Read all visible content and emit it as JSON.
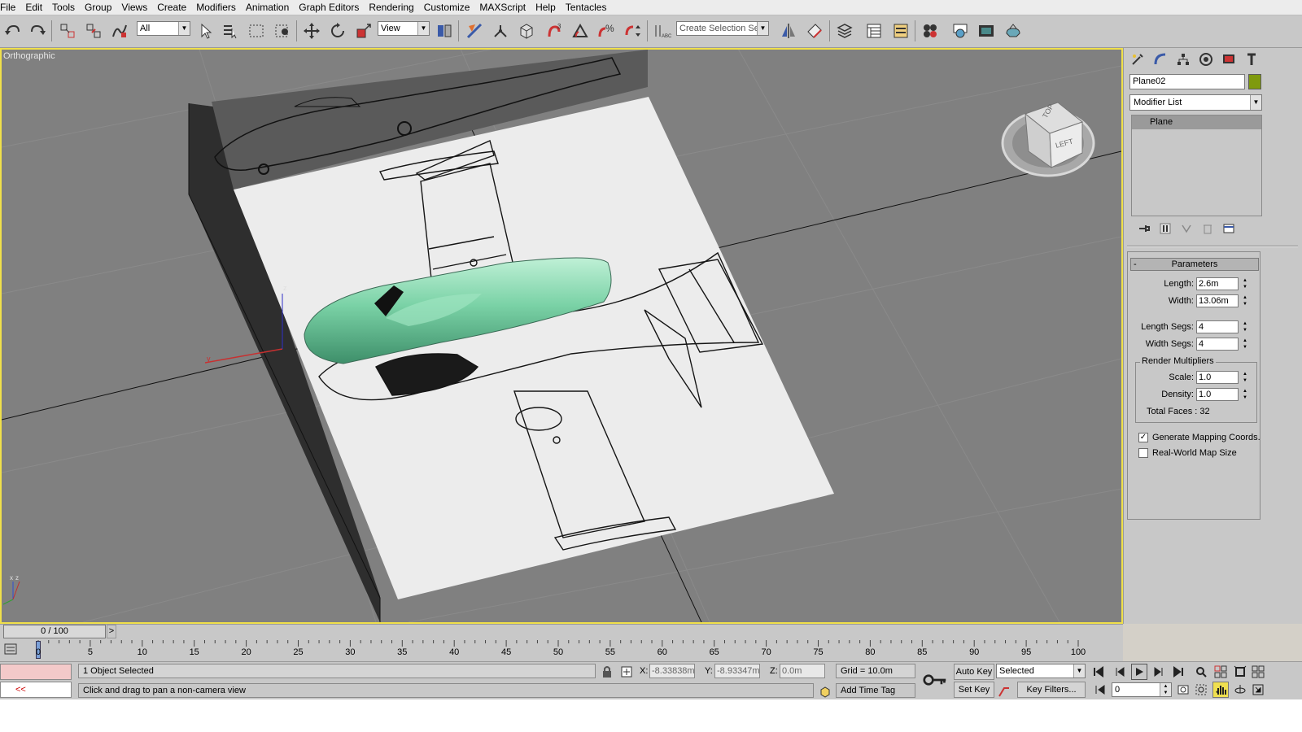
{
  "menu": [
    "File",
    "Edit",
    "Tools",
    "Group",
    "Views",
    "Create",
    "Modifiers",
    "Animation",
    "Graph Editors",
    "Rendering",
    "Customize",
    "MAXScript",
    "Help",
    "Tentacles"
  ],
  "toolbar": {
    "selection_filter": "All",
    "ref_coord": "View",
    "named_selection_placeholder": "Create Selection Set",
    "icons": [
      "undo-icon",
      "redo-icon",
      "select-link-icon",
      "unlink-icon",
      "bind-spacewarp-icon",
      "select-object-icon",
      "select-by-name-icon",
      "rect-region-icon",
      "window-crossing-icon",
      "move-icon",
      "rotate-icon",
      "scale-icon",
      "pivot-icon",
      "manipulate-icon",
      "keyboard-shortcut-icon",
      "snap-icon",
      "angle-snap-icon",
      "percent-snap-icon",
      "spinner-snap-icon",
      "edit-named-selection-icon",
      "mirror-icon",
      "align-icon",
      "layer-manager-icon",
      "ribbon-icon",
      "curve-editor-icon",
      "schematic-icon",
      "material-editor-icon",
      "render-setup-icon",
      "rendered-frame-icon",
      "render-icon"
    ]
  },
  "viewport": {
    "label": "Orthographic",
    "viewcube_top": "TOP",
    "viewcube_left": "LEFT",
    "axis_z": "z",
    "axis_y": "y",
    "tripod_x": "x",
    "tripod_z": "z"
  },
  "command_panel": {
    "object_name": "Plane02",
    "object_color": "#7f9a0e",
    "modifier_list": "Modifier List",
    "stack_item": "Plane",
    "rollout_title": "Parameters",
    "params": [
      {
        "label": "Length:",
        "value": "2.6m"
      },
      {
        "label": "Width:",
        "value": "13.06m"
      },
      {
        "label": "Length Segs:",
        "value": "4"
      },
      {
        "label": "Width Segs:",
        "value": "4"
      }
    ],
    "render_multipliers_title": "Render Multipliers",
    "scale_label": "Scale:",
    "scale_value": "1.0",
    "density_label": "Density:",
    "density_value": "1.0",
    "total_faces": "Total Faces : 32",
    "gen_mapping": "Generate Mapping Coords.",
    "gen_mapping_checked": true,
    "real_world": "Real-World Map Size",
    "real_world_checked": false
  },
  "timeline": {
    "frame_display": "0 / 100",
    "next_label": ">",
    "ticks": [
      "0",
      "5",
      "10",
      "15",
      "20",
      "25",
      "30",
      "35",
      "40",
      "45",
      "50",
      "55",
      "60",
      "65",
      "70",
      "75",
      "80",
      "85",
      "90",
      "95",
      "100"
    ]
  },
  "status": {
    "maxscript_btn": "<<",
    "selection_info": "1 Object Selected",
    "prompt": "Click and drag to pan a non-camera view",
    "x_label": "X:",
    "x_value": "-8.33838m",
    "y_label": "Y:",
    "y_value": "-8.93347m",
    "z_label": "Z:",
    "z_value": "0.0m",
    "grid": "Grid = 10.0m",
    "add_time_tag": "Add Time Tag",
    "auto_key": "Auto Key",
    "set_key": "Set Key",
    "selected_filter": "Selected",
    "key_filters": "Key Filters...",
    "current_frame": "0"
  }
}
